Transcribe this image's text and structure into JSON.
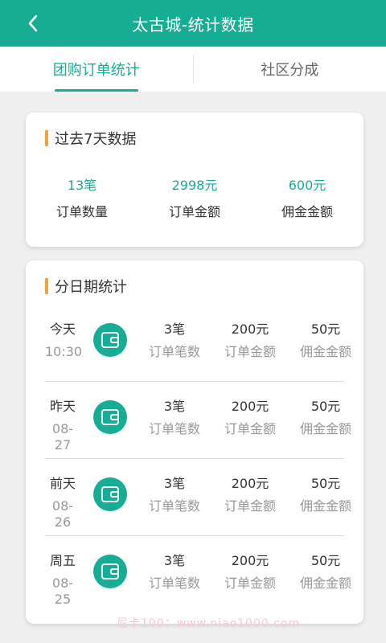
{
  "header": {
    "title": "太古城-统计数据"
  },
  "tabs": [
    {
      "label": "团购订单统计"
    },
    {
      "label": "社区分成"
    }
  ],
  "summary": {
    "title": "过去7天数据",
    "stats": [
      {
        "value": "13笔",
        "label": "订单数量"
      },
      {
        "value": "2998元",
        "label": "订单金额"
      },
      {
        "value": "600元",
        "label": "佣金金额"
      }
    ]
  },
  "daily": {
    "title": "分日期统计",
    "rows": [
      {
        "day": "今天",
        "date": "10:30",
        "count": "3笔",
        "count_label": "订单笔数",
        "amount": "200元",
        "amount_label": "订单金额",
        "commission": "50元",
        "commission_label": "佣金金额"
      },
      {
        "day": "昨天",
        "date": "08-27",
        "count": "3笔",
        "count_label": "订单笔数",
        "amount": "200元",
        "amount_label": "订单金额",
        "commission": "50元",
        "commission_label": "佣金金额"
      },
      {
        "day": "前天",
        "date": "08-26",
        "count": "3笔",
        "count_label": "订单笔数",
        "amount": "200元",
        "amount_label": "订单金额",
        "commission": "50元",
        "commission_label": "佣金金额"
      },
      {
        "day": "周五",
        "date": "08-25",
        "count": "3笔",
        "count_label": "订单笔数",
        "amount": "200元",
        "amount_label": "订单金额",
        "commission": "50元",
        "commission_label": "佣金金额"
      }
    ]
  },
  "watermark": "尼卡100：www.niao1000.com",
  "colors": {
    "primary": "#17ad95",
    "accent": "#f0a43a"
  },
  "icons": {
    "back": "chevron-left-icon",
    "row": "wallet-icon"
  }
}
